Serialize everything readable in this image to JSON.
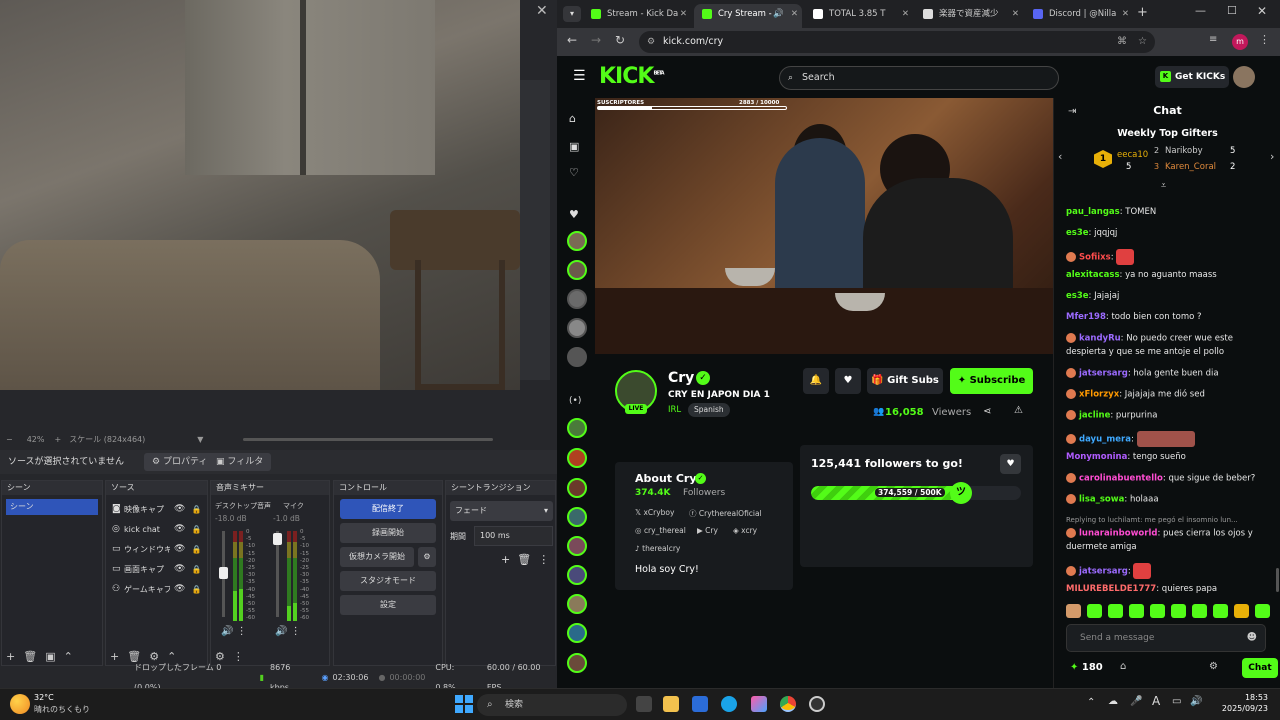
{
  "obs": {
    "close": "✕",
    "zoom": "42%",
    "scale": "スケール (824x464)",
    "no_source": "ソースが選択されていません",
    "properties": "プロパティ",
    "filters": "フィルタ",
    "docks": {
      "scenes": "シーン",
      "sources": "ソース",
      "mixer": "音声ミキサー",
      "controls": "コントロール",
      "transitions": "シーントランジション"
    },
    "scene_items": [
      "シーン"
    ],
    "source_items": [
      {
        "icon": "camera-icon",
        "glyph": "◙",
        "name": "映像キャプ"
      },
      {
        "icon": "browser-icon",
        "glyph": "◎",
        "name": "kick chat"
      },
      {
        "icon": "window-icon",
        "glyph": "▭",
        "name": "ウィンドウキ"
      },
      {
        "icon": "display-icon",
        "glyph": "▭",
        "name": "画面キャプ"
      },
      {
        "icon": "gamepad-icon",
        "glyph": "⚇",
        "name": "ゲームキャプ"
      }
    ],
    "mixer": {
      "ch1": {
        "name": "デスクトップ音声",
        "db": "-18.0 dB"
      },
      "ch2": {
        "name": "マイク",
        "db": "-1.0 dB"
      },
      "scale": [
        "0",
        "-5",
        "-10",
        "-15",
        "-20",
        "-25",
        "-30",
        "-35",
        "-40",
        "-45",
        "-50",
        "-55",
        "-60"
      ]
    },
    "controls": {
      "stop_stream": "配信終了",
      "record": "録画開始",
      "virtual_cam": "仮想カメラ開始",
      "studio": "スタジオモード",
      "settings": "設定"
    },
    "transition": {
      "type": "フェード",
      "duration_label": "期間",
      "duration": "100 ms"
    },
    "status": {
      "dropped": "ドロップしたフレーム 0 (0.0%)",
      "kbps": "8676 kbps",
      "stream_time": "02:30:06",
      "rec_time": "00:00:00",
      "cpu": "CPU: 0.8%",
      "fps": "60.00 / 60.00 FPS"
    }
  },
  "browser": {
    "tabs": [
      {
        "title": "Stream - Kick Da",
        "icon": "kick-icon",
        "color": "#53fc18",
        "active": false
      },
      {
        "title": "Cry Stream - ",
        "icon": "kick-icon",
        "color": "#53fc18",
        "active": true
      },
      {
        "title": "TOTAL 3.85 T",
        "icon": "tradingview-icon",
        "color": "#ffffff",
        "active": false
      },
      {
        "title": "楽器で資産減少",
        "icon": "web-icon",
        "color": "#dddddd",
        "active": false
      },
      {
        "title": "Discord | @Nilla",
        "icon": "discord-icon",
        "color": "#5865f2",
        "active": false
      }
    ],
    "url": "kick.com/cry",
    "profile_initial": "m"
  },
  "kick": {
    "logo": "KICK",
    "beta": "BETA",
    "search_placeholder": "Search",
    "get_kicks": "Get KICKs",
    "sub_goal": {
      "label": "SUSCRIPTORES",
      "count": "2883 / 10000",
      "progress": 0.288
    },
    "channel": {
      "name": "Cry",
      "live": "LIVE",
      "title": "CRY EN JAPON DIA 1",
      "category": "IRL",
      "language": "Spanish",
      "viewers": "16,058",
      "viewers_label": "Viewers",
      "gift_subs": "Gift Subs",
      "subscribe": "Subscribe"
    },
    "about": {
      "title": "About Cry",
      "followers_count": "374.4K",
      "followers_label": "Followers",
      "socials": [
        "xCryboy",
        "CrytherealOficial",
        "cry_thereal",
        "Cry",
        "xcry",
        "therealcry"
      ],
      "bio": "Hola soy Cry!"
    },
    "goal": {
      "title": "125,441 followers to go!",
      "label": "374,559 / 500K",
      "progress": 0.749
    },
    "chat": {
      "title": "Chat",
      "top_gifters_title": "Weekly Top Gifters",
      "gifters": [
        {
          "rank": "1",
          "name": "eeca10",
          "count": "5"
        },
        {
          "rank": "2",
          "name": "Narikoby",
          "count": "5"
        },
        {
          "rank": "3",
          "name": "Karen_Coral",
          "count": "2"
        }
      ],
      "messages": [
        {
          "user": "pau_langas",
          "color": "#53fc18",
          "text": "TOMEN"
        },
        {
          "user": "es3e",
          "color": "#53fc18",
          "text": "jqqjqj"
        },
        {
          "user": "Sofiixs",
          "color": "#ff4d4d",
          "text": ""
        },
        {
          "user": "alexitacass",
          "color": "#53fc18",
          "text": "ya no aguanto maass"
        },
        {
          "user": "es3e",
          "color": "#53fc18",
          "text": "Jajajaj"
        },
        {
          "user": "Mfer198",
          "color": "#9c6bff",
          "text": "todo bien con tomo ?"
        },
        {
          "user": "kandyRu",
          "color": "#9c6bff",
          "text": "No puedo creer wue este"
        },
        {
          "user": "",
          "color": "#ffffff",
          "text": "despierta y que se me antoje el pollo"
        },
        {
          "user": "jatsersarg",
          "color": "#9c6bff",
          "text": "hola gente buen dia"
        },
        {
          "user": "xFlorzyx",
          "color": "#ff9900",
          "text": "Jajajaja me dió sed"
        },
        {
          "user": "jacline",
          "color": "#53fc18",
          "text": "purpurina"
        },
        {
          "user": "dayu_mera",
          "color": "#3fa9ff",
          "text": ""
        },
        {
          "user": "Monymonina",
          "color": "#b05cff",
          "text": "tengo sueño"
        },
        {
          "user": "carolinabuentello",
          "color": "#ff4dd2",
          "text": "que sigue de beber?"
        },
        {
          "user": "lisa_sowa",
          "color": "#53fc18",
          "text": "holaaa"
        },
        {
          "user": "",
          "color": "#aaaaaa",
          "text": "Replying to luchilamt: me pegó el insomnio lun..."
        },
        {
          "user": "lunarainboworld",
          "color": "#ff4dd2",
          "text": "pues cierra los ojos y"
        },
        {
          "user": "",
          "color": "#ffffff",
          "text": "duermete amiga"
        },
        {
          "user": "jatsersarg",
          "color": "#9c6bff",
          "text": ""
        },
        {
          "user": "MILUREBELDE1777",
          "color": "#ff6b6b",
          "text": "quieres papa"
        }
      ],
      "input_placeholder": "Send a message",
      "points": "180",
      "send": "Chat"
    }
  },
  "taskbar": {
    "weather_temp": "32°C",
    "weather_desc": "晴れのちくもり",
    "search_placeholder": "検索",
    "time": "18:53",
    "date": "2025/09/23",
    "ime": "A"
  }
}
